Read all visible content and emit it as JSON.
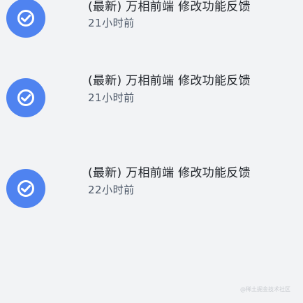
{
  "list": {
    "items": [
      {
        "title": "(最新) 万相前端 修改功能反馈",
        "time": "21小时前",
        "icon": "check-circle-icon"
      },
      {
        "title": "(最新) 万相前端 修改功能反馈",
        "time": "21小时前",
        "icon": "check-circle-icon"
      },
      {
        "title": "(最新) 万相前端 修改功能反馈",
        "time": "22小时前",
        "icon": "check-circle-icon"
      }
    ]
  },
  "watermark": "@稀土掘金技术社区",
  "colors": {
    "accent": "#4f83f0",
    "background": "#f2f3f5",
    "title": "#1f2329",
    "subtitle": "#4e5969"
  }
}
